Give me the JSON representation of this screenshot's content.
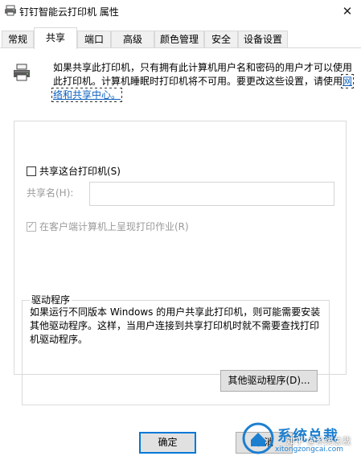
{
  "window": {
    "title": "钉钉智能云打印机 属性",
    "close_glyph": "✕"
  },
  "tabs": [
    {
      "label": "常规",
      "active": false
    },
    {
      "label": "共享",
      "active": true
    },
    {
      "label": "端口",
      "active": false
    },
    {
      "label": "高级",
      "active": false
    },
    {
      "label": "颜色管理",
      "active": false
    },
    {
      "label": "安全",
      "active": false
    },
    {
      "label": "设备设置",
      "active": false
    }
  ],
  "share_tab": {
    "icon": "printer-icon",
    "info_text": "如果共享此打印机，只有拥有此计算机用户名和密码的用户才可以使用此打印机。计算机睡眠时打印机将不可用。要更改这些设置，请使用",
    "info_link": "网络和共享中心。",
    "share_checkbox_label": "共享这台打印机(S)",
    "share_checked": false,
    "share_name_label": "共享名(H):",
    "share_name_value": "",
    "render_jobs_label": "在客户端计算机上呈现打印作业(R)",
    "render_jobs_checked": true
  },
  "drivers": {
    "title": "驱动程序",
    "text": "如果运行不同版本 Windows 的用户共享此打印机，则可能需要安装其他驱动程序。这样，当用户连接到共享打印机时就不需要查找打印机驱动程序。",
    "button_label": "其他驱动程序(D)..."
  },
  "footer": {
    "ok_label": "确定",
    "cancel_label": "取消"
  },
  "watermark": {
    "brand": "系统总裁",
    "url": "xitongzongcai.com",
    "zhihu": "知乎 @系统总裁"
  },
  "colors": {
    "accent": "#0078d7",
    "link": "#0b5fbd",
    "watermark": "#1d7fd0"
  }
}
